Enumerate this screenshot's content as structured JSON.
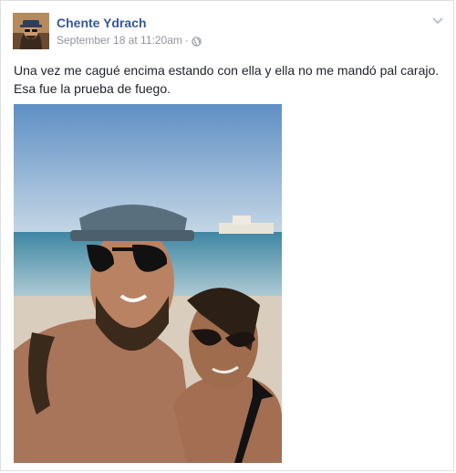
{
  "post": {
    "author_name": "Chente Ydrach",
    "timestamp": "September 18 at 11:20am",
    "separator": "·",
    "privacy_icon": "globe-icon",
    "menu_icon": "chevron-down-icon",
    "text": "Una vez me cagué encima estando con ella y ella no me mandó pal carajo. Esa fue la prueba de fuego.",
    "photo_alt": "Selfie of a couple on the beach",
    "colors": {
      "name_link": "#365899",
      "meta_gray": "#90949c",
      "text": "#1d2129",
      "border": "#dddfe2"
    }
  }
}
